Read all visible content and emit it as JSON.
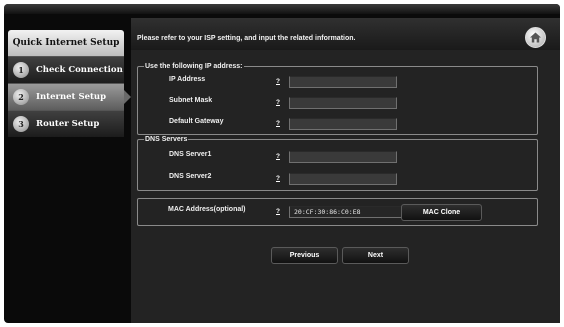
{
  "sidebar": {
    "title": "Quick Internet Setup",
    "items": [
      {
        "step": "1",
        "label": "Check Connection",
        "active": false
      },
      {
        "step": "2",
        "label": "Internet Setup",
        "active": true
      },
      {
        "step": "3",
        "label": "Router Setup",
        "active": false
      }
    ]
  },
  "header": {
    "instruction": "Please refer to your ISP setting, and input the related information."
  },
  "ip_section": {
    "legend": "Use the following IP address:",
    "ip_label": "IP Address",
    "subnet_label": "Subnet Mask",
    "gateway_label": "Default Gateway",
    "ip_value": "",
    "subnet_value": "",
    "gateway_value": ""
  },
  "dns_section": {
    "legend": "DNS Servers",
    "dns1_label": "DNS Server1",
    "dns2_label": "DNS Server2",
    "dns1_value": "",
    "dns2_value": ""
  },
  "mac_section": {
    "label": "MAC Address(optional)",
    "value": "20:CF:30:86:C0:E8",
    "clone_label": "MAC Clone"
  },
  "help_symbol": "?",
  "nav": {
    "previous_label": "Previous",
    "next_label": "Next"
  }
}
